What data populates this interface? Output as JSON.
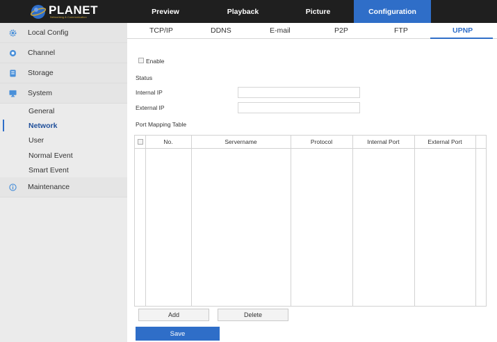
{
  "brand": {
    "name": "PLANET",
    "tagline": "Networking & Communication",
    "accent_color": "#2f6ec8",
    "topbar_color": "#1f1f1f"
  },
  "topnav": {
    "items": [
      {
        "label": "Preview",
        "active": false
      },
      {
        "label": "Playback",
        "active": false
      },
      {
        "label": "Picture",
        "active": false
      },
      {
        "label": "Configuration",
        "active": true
      }
    ]
  },
  "sidebar": {
    "items": [
      {
        "label": "Local Config",
        "icon": "gear-icon"
      },
      {
        "label": "Channel",
        "icon": "camera-icon"
      },
      {
        "label": "Storage",
        "icon": "storage-icon"
      },
      {
        "label": "System",
        "icon": "monitor-icon"
      },
      {
        "label": "Maintenance",
        "icon": "info-icon"
      }
    ],
    "system_subitems": [
      {
        "label": "General",
        "active": false
      },
      {
        "label": "Network",
        "active": true
      },
      {
        "label": "User",
        "active": false
      },
      {
        "label": "Normal Event",
        "active": false
      },
      {
        "label": "Smart Event",
        "active": false
      }
    ]
  },
  "tabs": {
    "items": [
      {
        "label": "TCP/IP",
        "active": false
      },
      {
        "label": "DDNS",
        "active": false
      },
      {
        "label": "E-mail",
        "active": false
      },
      {
        "label": "P2P",
        "active": false
      },
      {
        "label": "FTP",
        "active": false
      },
      {
        "label": "UPNP",
        "active": true
      }
    ]
  },
  "form": {
    "enable_label": "Enable",
    "enable_checked": false,
    "status_label": "Status",
    "internal_ip_label": "Internal IP",
    "internal_ip_value": "",
    "external_ip_label": "External IP",
    "external_ip_value": "",
    "port_table_label": "Port Mapping Table"
  },
  "port_table": {
    "columns": [
      "No.",
      "Servername",
      "Protocol",
      "Internal Port",
      "External Port"
    ],
    "rows": []
  },
  "buttons": {
    "add": "Add",
    "delete": "Delete",
    "save": "Save"
  }
}
